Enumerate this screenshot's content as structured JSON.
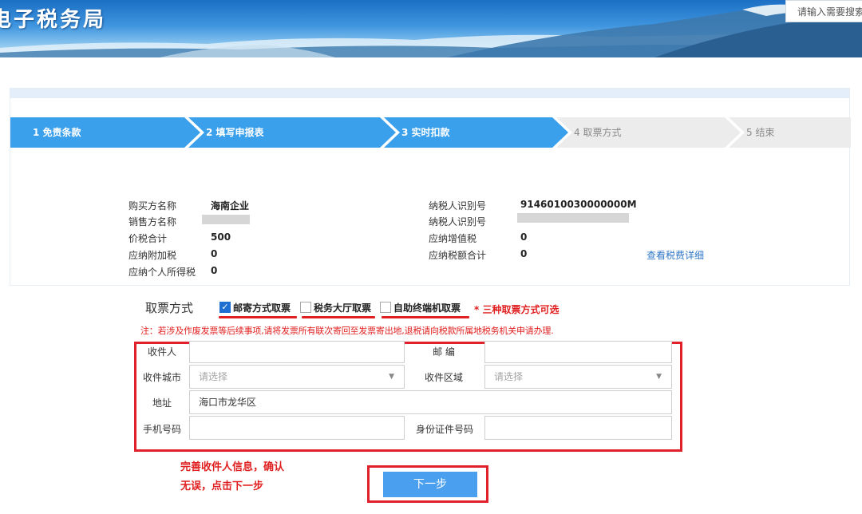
{
  "header": {
    "title": "电子税务局",
    "search_placeholder": "请输入需要搜索"
  },
  "steps": [
    {
      "label": "1 免责条款",
      "state": "done"
    },
    {
      "label": "2 填写申报表",
      "state": "done"
    },
    {
      "label": "3 实时扣款",
      "state": "done"
    },
    {
      "label": "4 取票方式",
      "state": "current"
    },
    {
      "label": "5 结束",
      "state": "pending"
    }
  ],
  "info": {
    "buyer_name_label": "购买方名称",
    "buyer_name_value": "海南企业",
    "seller_name_label": "销售方名称",
    "total_label": "价税合计",
    "total_value": "500",
    "surcharge_label": "应纳附加税",
    "surcharge_value": "0",
    "income_tax_label": "应纳个人所得税",
    "income_tax_value": "0",
    "buyer_taxid_label": "纳税人识别号",
    "buyer_taxid_value": "9146010030000000M",
    "seller_taxid_label": "纳税人识别号",
    "vat_label": "应纳增值税",
    "vat_value": "0",
    "tax_total_label": "应纳税额合计",
    "tax_total_value": "0",
    "detail_link": "查看税费详细"
  },
  "ticket": {
    "title": "取票方式",
    "options": [
      {
        "label": "邮寄方式取票",
        "checked": true
      },
      {
        "label": "税务大厅取票",
        "checked": false
      },
      {
        "label": "自助终端机取票",
        "checked": false
      }
    ],
    "hint": "* 三种取票方式可选",
    "note": "注：若涉及作废发票等后续事项,请将发票所有联次寄回至发票寄出地,退税请向税款所属地税务机关申请办理."
  },
  "form": {
    "recipient_label": "收件人",
    "recipient_value": "",
    "postcode_label": "邮 编",
    "postcode_value": "",
    "city_label": "收件城市",
    "city_placeholder": "请选择",
    "district_label": "收件区域",
    "district_placeholder": "请选择",
    "address_label": "地址",
    "address_value": "海口市龙华区",
    "phone_label": "手机号码",
    "phone_value": "",
    "id_label": "身份证件号码",
    "id_value": ""
  },
  "annotation": {
    "tip": "完善收件人信息，确认无误，点击下一步"
  },
  "next_button": "下一步",
  "colors": {
    "step_active": "#3aa0ec",
    "step_inactive": "#ececec",
    "annotation_red": "#e0202a",
    "button_blue": "#4aa0ee",
    "link_blue": "#2f76c5"
  }
}
